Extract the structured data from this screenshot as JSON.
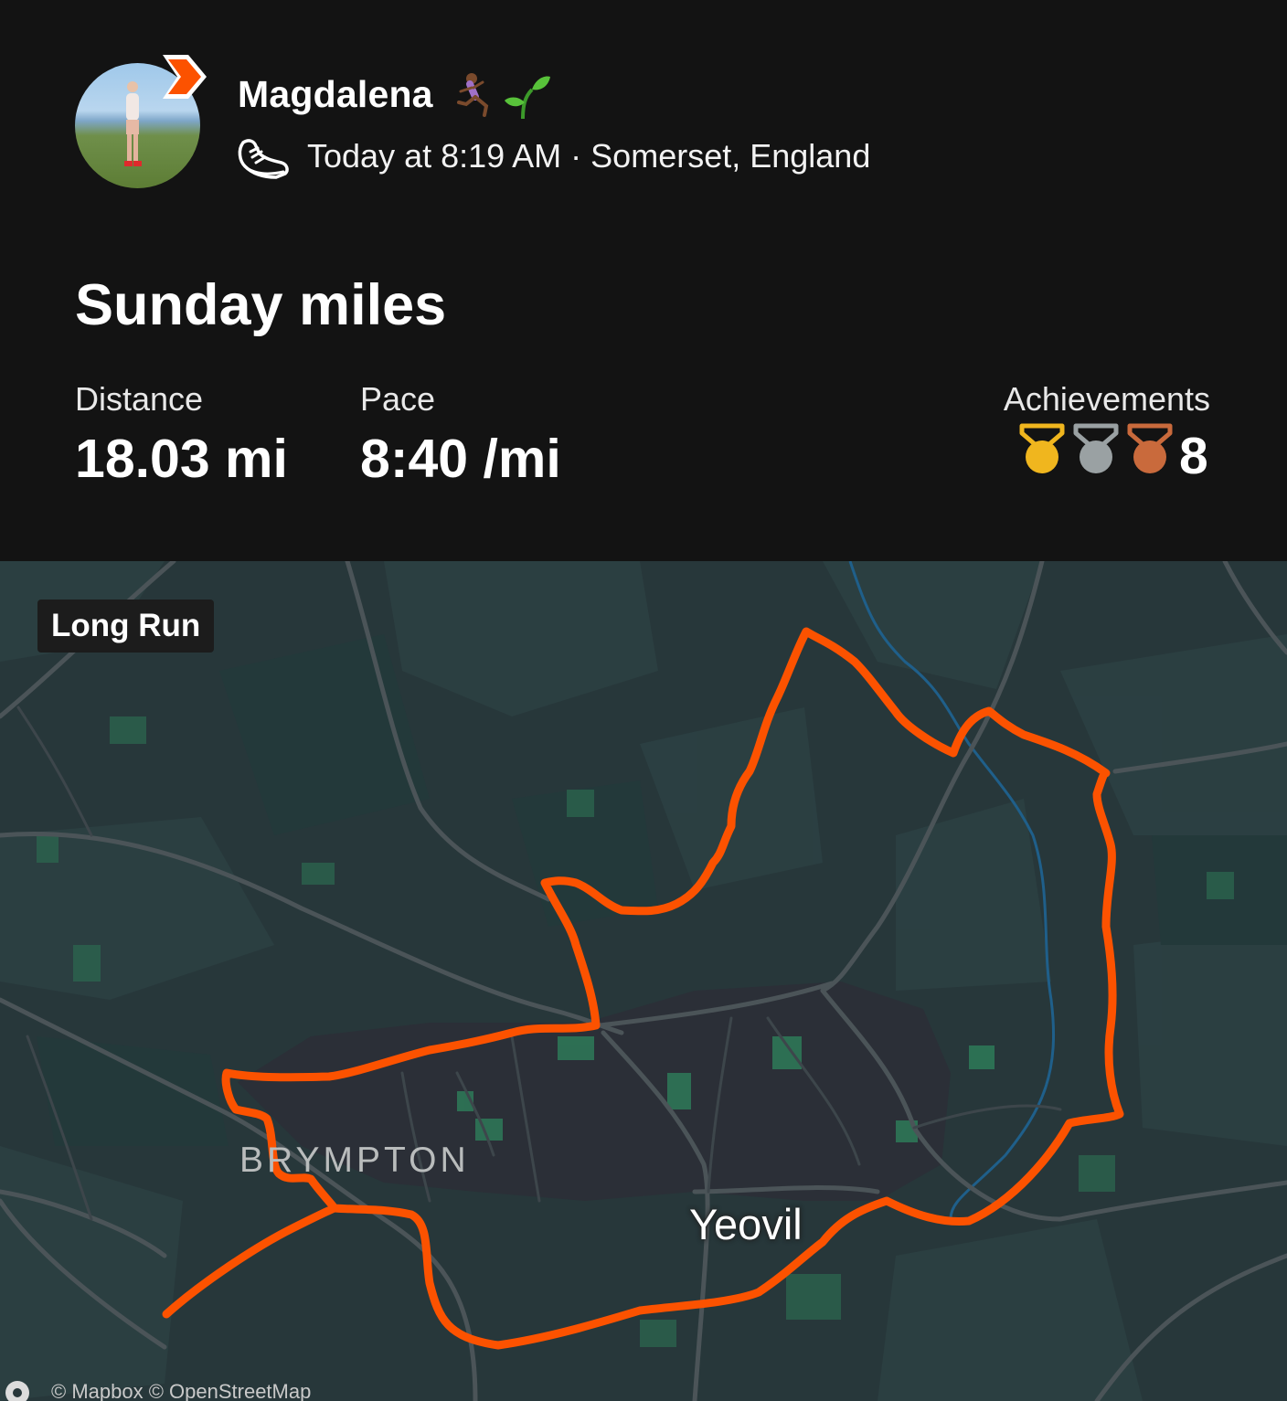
{
  "activity": {
    "athlete_name": "Magdalena",
    "athlete_emoji": "🏃🏽‍♀️🌱",
    "meta": "Today at 8:19 AM · Somerset, England",
    "title": "Sunday miles"
  },
  "stats": {
    "distance_label": "Distance",
    "distance_value": "18.03 mi",
    "pace_label": "Pace",
    "pace_value": "8:40 /mi",
    "achievements_label": "Achievements",
    "achievements_count": "8"
  },
  "medals": [
    "gold-medal-icon",
    "silver-medal-icon",
    "bronze-medal-icon"
  ],
  "colors": {
    "background": "#131313",
    "route": "#fc5200",
    "map_base": "#27373a",
    "gold": "#f0b61e",
    "silver": "#9aa1a3",
    "bronze": "#c96a3c"
  },
  "map": {
    "tag": "Long Run",
    "labels": {
      "area": "BRYMPTON",
      "town": "Yeovil"
    },
    "attribution": "© Mapbox © OpenStreetMap"
  }
}
